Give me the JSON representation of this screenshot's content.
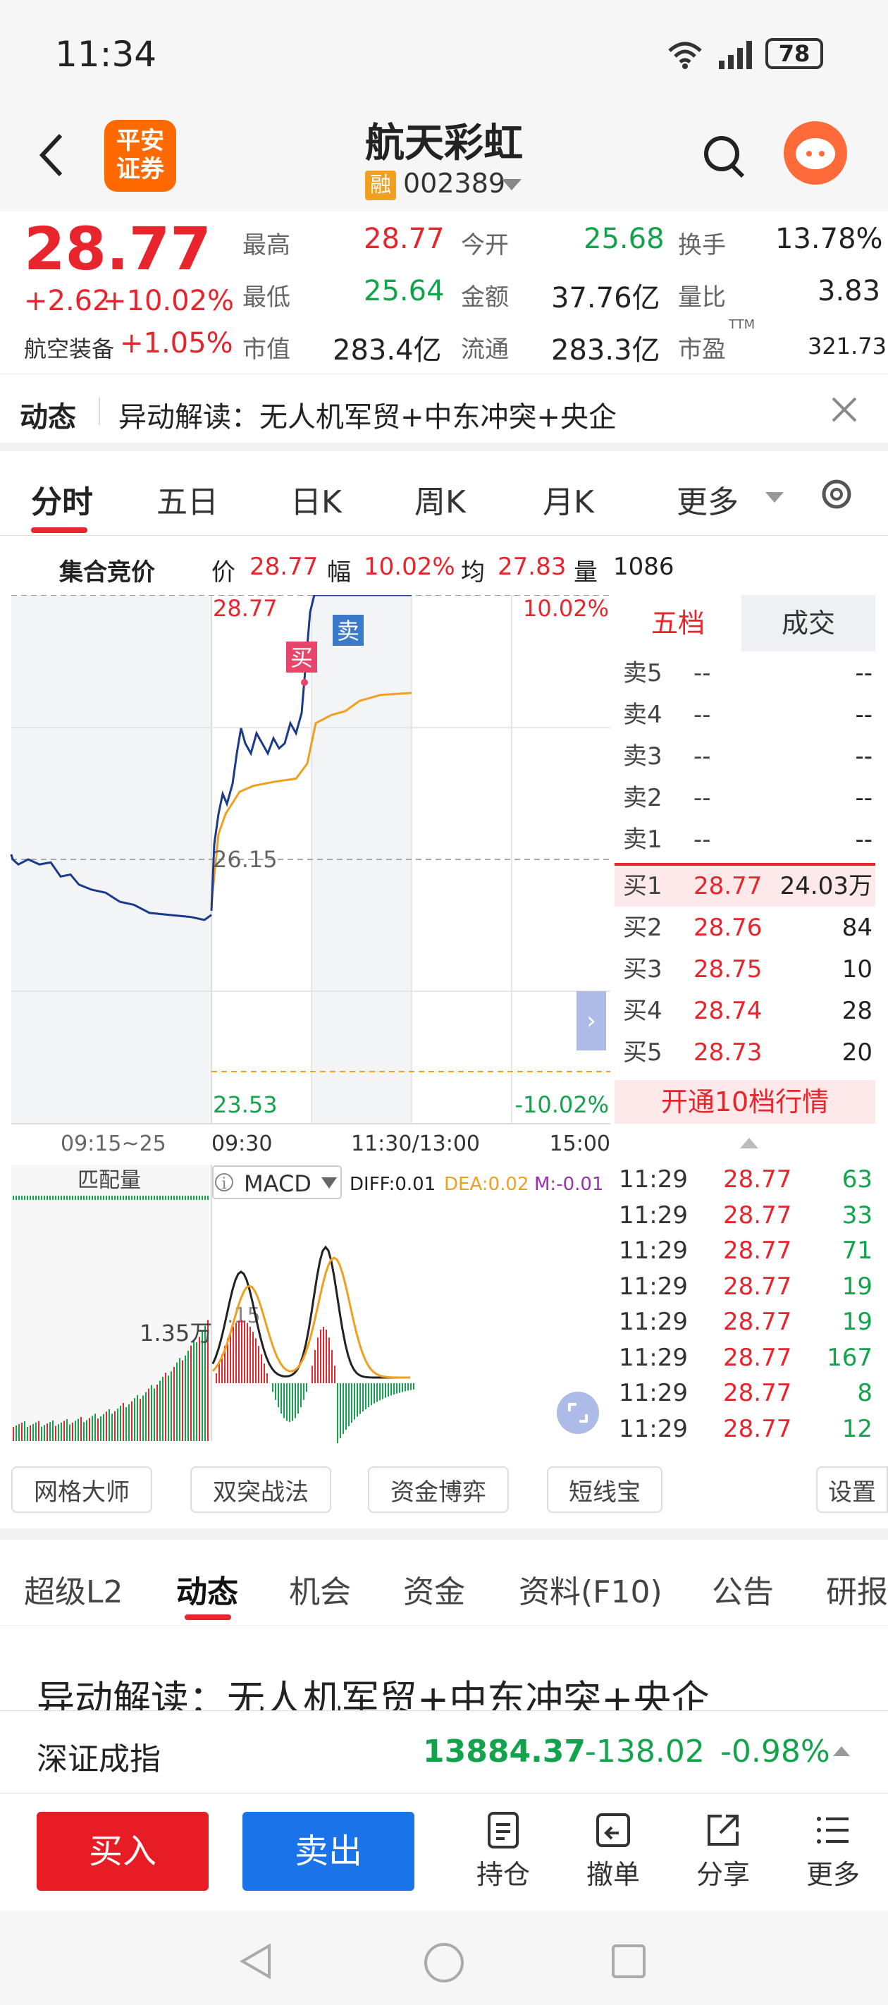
{
  "status": {
    "time": "11:34",
    "battery": "78"
  },
  "header": {
    "logo": "平安\n证券",
    "stock_name": "航天彩虹",
    "margin_badge": "融",
    "stock_code": "002389"
  },
  "quote": {
    "price": "28.77",
    "change": "+2.62",
    "change_pct": "+10.02%",
    "sector": "航空装备",
    "sector_pct": "+1.05%",
    "fields": [
      {
        "label": "最高",
        "value": "28.77",
        "color": "red"
      },
      {
        "label": "今开",
        "value": "25.68",
        "color": "green"
      },
      {
        "label": "换手",
        "value": "13.78%",
        "color": "black"
      },
      {
        "label": "最低",
        "value": "25.64",
        "color": "green"
      },
      {
        "label": "金额",
        "value": "37.76亿",
        "color": "black"
      },
      {
        "label": "量比",
        "value": "3.83",
        "color": "black"
      },
      {
        "label": "市值",
        "value": "283.4亿",
        "color": "black"
      },
      {
        "label": "流通",
        "value": "283.3亿",
        "color": "black"
      },
      {
        "label": "市盈",
        "value": "321.73",
        "color": "black"
      }
    ],
    "pe_suffix": "TTM"
  },
  "dynamic": {
    "tag": "动态",
    "text": "异动解读：无人机军贸+中东冲突+央企"
  },
  "chart_tabs": [
    "分时",
    "五日",
    "日K",
    "周K",
    "月K",
    "更多"
  ],
  "auction": {
    "label": "集合竞价",
    "price_label": "价",
    "price": "28.77",
    "amp_label": "幅",
    "amp": "10.02%",
    "avg_label": "均",
    "avg": "27.83",
    "vol_label": "量",
    "vol": "1086"
  },
  "chart": {
    "price_high": "28.77",
    "pct_high": "10.02%",
    "price_mid": "26.15",
    "price_low": "23.53",
    "pct_low": "-10.02%",
    "buy_marker": "买",
    "sell_marker": "卖",
    "time_labels": [
      "09:15~25",
      "09:30",
      "11:30/13:00",
      "15:00"
    ],
    "volume_label": "匹配量",
    "volume_value": "1.35万",
    "volume_partial": ".15",
    "macd": {
      "name": "MACD",
      "diff": "DIFF:0.01",
      "dea": "DEA:0.02",
      "m": "M:-0.01"
    }
  },
  "book": {
    "tabs": [
      "五档",
      "成交"
    ],
    "asks": [
      {
        "label": "卖5",
        "price": "--",
        "vol": "--"
      },
      {
        "label": "卖4",
        "price": "--",
        "vol": "--"
      },
      {
        "label": "卖3",
        "price": "--",
        "vol": "--"
      },
      {
        "label": "卖2",
        "price": "--",
        "vol": "--"
      },
      {
        "label": "卖1",
        "price": "--",
        "vol": "--"
      }
    ],
    "bids": [
      {
        "label": "买1",
        "price": "28.77",
        "vol": "24.03万"
      },
      {
        "label": "买2",
        "price": "28.76",
        "vol": "84"
      },
      {
        "label": "买3",
        "price": "28.75",
        "vol": "10"
      },
      {
        "label": "买4",
        "price": "28.74",
        "vol": "28"
      },
      {
        "label": "买5",
        "price": "28.73",
        "vol": "20"
      }
    ],
    "upgrade": "开通10档行情"
  },
  "ticks": [
    {
      "time": "11:29",
      "price": "28.77",
      "vol": "63"
    },
    {
      "time": "11:29",
      "price": "28.77",
      "vol": "33"
    },
    {
      "time": "11:29",
      "price": "28.77",
      "vol": "71"
    },
    {
      "time": "11:29",
      "price": "28.77",
      "vol": "19"
    },
    {
      "time": "11:29",
      "price": "28.77",
      "vol": "19"
    },
    {
      "time": "11:29",
      "price": "28.77",
      "vol": "167"
    },
    {
      "time": "11:29",
      "price": "28.77",
      "vol": "8"
    },
    {
      "time": "11:29",
      "price": "28.77",
      "vol": "12"
    }
  ],
  "tools": [
    "网格大师",
    "双突战法",
    "资金博弈",
    "短线宝",
    "设置"
  ],
  "bottom_tabs": [
    "超级L2",
    "动态",
    "机会",
    "资金",
    "资料(F10)",
    "公告",
    "研报"
  ],
  "news_title": "异动解读：无人机军贸+中东冲突+央企",
  "index": {
    "name": "深证成指",
    "value": "13884.37",
    "change": "-138.02",
    "pct": "-0.98%"
  },
  "trade": {
    "buy": "买入",
    "sell": "卖出",
    "actions": [
      "持仓",
      "撤单",
      "分享",
      "更多"
    ]
  },
  "colors": {
    "up": "#e8242c",
    "down": "#12a34c",
    "line": "#1a3a8a",
    "avg": "#f0a020",
    "accent": "#ff6a00"
  }
}
